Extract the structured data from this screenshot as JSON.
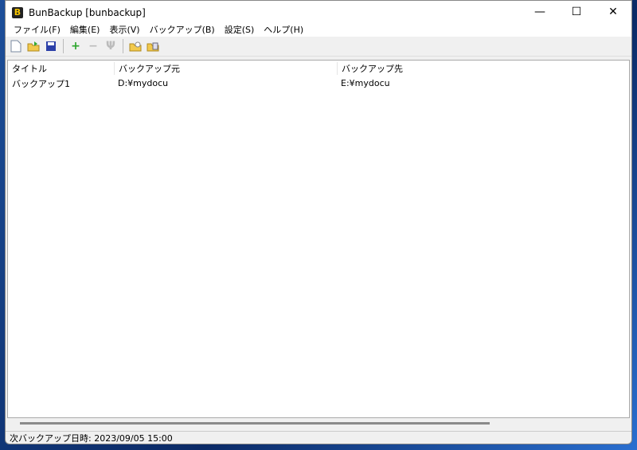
{
  "window": {
    "title": "BunBackup [bunbackup]",
    "minimize": "—",
    "maximize": "☐",
    "close": "✕"
  },
  "menu": [
    "ファイル(F)",
    "編集(E)",
    "表示(V)",
    "バックアップ(B)",
    "設定(S)",
    "ヘルプ(H)"
  ],
  "list": {
    "columns": [
      "タイトル",
      "バックアップ元",
      "バックアップ先"
    ],
    "rows": [
      [
        "バックアップ1",
        "D:¥mydocu",
        "E:¥mydocu"
      ]
    ]
  },
  "status": "次バックアップ日時: 2023/09/05 15:00"
}
